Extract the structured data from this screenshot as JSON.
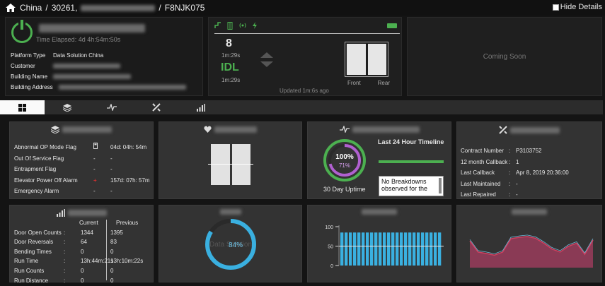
{
  "breadcrumb": {
    "country": "China",
    "site_code": "30261,",
    "unit": "F8NJK075",
    "sep": "/"
  },
  "hide_details_label": "Hide Details",
  "info": {
    "elapsed": "Time Elapsed: 4d 4h:54m:50s",
    "rows": [
      {
        "label": "Platform Type",
        "value": "Data Solution China"
      },
      {
        "label": "Customer",
        "value": ""
      },
      {
        "label": "Building Name",
        "value": ""
      },
      {
        "label": "Building Address",
        "value": ""
      }
    ]
  },
  "status": {
    "floor": "8",
    "time1": "1m:29s",
    "state": "IDL",
    "time2": "1m:29s",
    "updated": "Updated 1m:6s ago",
    "door_front": "Front",
    "door_rear": "Rear"
  },
  "coming_soon": "Coming Soon",
  "tabs": [
    "dashboard-icon",
    "layers-icon",
    "pulse-icon",
    "tools-icon",
    "signal-bars-icon"
  ],
  "op_card": {
    "rows": [
      {
        "label": "Abnormal OP Mode Flag",
        "icon": "door-icon",
        "value": "04d: 04h: 54m"
      },
      {
        "label": "Out Of Service Flag",
        "icon": "",
        "value": "-"
      },
      {
        "label": "Entrapment Flag",
        "icon": "",
        "value": "-"
      },
      {
        "label": "Elevator Power Off Alarm",
        "icon": "plus-icon",
        "value": "157d: 07h: 57m"
      },
      {
        "label": "Emergency Alarm",
        "icon": "",
        "value": "-"
      }
    ],
    "dash": "-"
  },
  "uptime": {
    "ring_outer": "100%",
    "ring_inner": "71%",
    "outer_pct": 100,
    "inner_pct": 71,
    "label": "30 Day Uptime",
    "timeline_title": "Last 24 Hour Timeline",
    "no_breakdowns": "No Breakdowns observed for the"
  },
  "contract": {
    "rows": [
      {
        "label": "Contract Number",
        "sep": ":",
        "value": "P3103752"
      },
      {
        "label": "12 month Callback",
        "sep": ":",
        "value": "1"
      },
      {
        "label": "Last Callback",
        "sep": ":",
        "value": "Apr 8, 2019 20:36:00"
      },
      {
        "label": "Last Maintained",
        "sep": ":",
        "value": "-"
      },
      {
        "label": "Last Repaired",
        "sep": ":",
        "value": "-"
      }
    ]
  },
  "counters": {
    "col_current": "Current",
    "col_previous": "Previous",
    "rows": [
      {
        "label": "Door Open Counts",
        "sep": ":",
        "current": "1344",
        "previous": "1395"
      },
      {
        "label": "Door Reversals",
        "sep": ":",
        "current": "64",
        "previous": "83"
      },
      {
        "label": "Bending Times",
        "sep": ":",
        "current": "0",
        "previous": "0"
      },
      {
        "label": "Run Time",
        "sep": ":",
        "current": "13h:44m:21s",
        "previous": "13h:10m:22s"
      },
      {
        "label": "Run Counts",
        "sep": ":",
        "current": "0",
        "previous": "0"
      },
      {
        "label": "Run Distance",
        "sep": ":",
        "current": "0",
        "previous": "0"
      }
    ]
  },
  "gauge": {
    "value": "84%",
    "pct": 84,
    "watermark": "Data Solution"
  },
  "colors": {
    "green": "#4cb050",
    "purple": "#b060d0",
    "blue": "#3ab0e0",
    "red": "#d04060"
  },
  "chart_data": [
    {
      "type": "bar",
      "title": "",
      "yticks": [
        "100",
        "50",
        "0"
      ],
      "ylim": [
        0,
        100
      ],
      "values": [
        85,
        85,
        85,
        85,
        85,
        85,
        85,
        85,
        85,
        85,
        85,
        85,
        85,
        85,
        85,
        85,
        85,
        85,
        85,
        85,
        85,
        85,
        85,
        85
      ]
    },
    {
      "type": "area",
      "title": "",
      "series": [
        {
          "values": [
            60,
            35,
            32,
            28,
            35,
            65,
            68,
            70,
            66,
            55,
            42,
            35,
            48,
            55,
            30,
            62
          ]
        }
      ]
    }
  ]
}
